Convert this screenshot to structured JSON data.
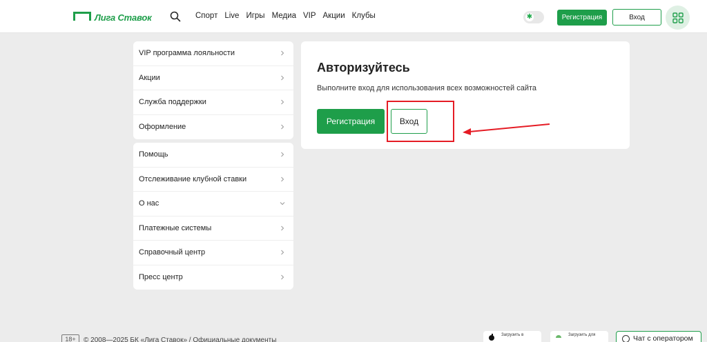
{
  "header": {
    "logo_text": "Лига Ставок",
    "nav": [
      "Спорт",
      "Live",
      "Игры",
      "Медиа",
      "VIP",
      "Акции",
      "Клубы"
    ],
    "register_label": "Регистрация",
    "login_label": "Вход",
    "toggle_glyph": "✱"
  },
  "sidebar": {
    "group1": [
      {
        "label": "VIP программа лояльности",
        "icon": "chevron-right-icon"
      },
      {
        "label": "Акции",
        "icon": "chevron-right-icon"
      },
      {
        "label": "Служба поддержки",
        "icon": "chevron-right-icon"
      },
      {
        "label": "Оформление",
        "icon": "chevron-right-icon"
      }
    ],
    "group2": [
      {
        "label": "Помощь",
        "icon": "chevron-right-icon"
      },
      {
        "label": "Отслеживание клубной ставки",
        "icon": "chevron-right-icon"
      },
      {
        "label": "О нас",
        "icon": "chevron-down-icon"
      },
      {
        "label": "Платежные системы",
        "icon": "chevron-right-icon"
      },
      {
        "label": "Справочный центр",
        "icon": "chevron-right-icon"
      },
      {
        "label": "Пресс центр",
        "icon": "chevron-right-icon"
      }
    ]
  },
  "auth": {
    "title": "Авторизуйтесь",
    "description": "Выполните вход для использования всех возможностей сайта",
    "register_label": "Регистрация",
    "login_label": "Вход"
  },
  "footer": {
    "age_badge": "18+",
    "copyright": "© 2008—2025 БК «Лига Ставок» / Официальные документы",
    "app_store_label": "Загрузить в",
    "google_play_label": "Загрузить для",
    "chat_label": "Чат с оператором"
  },
  "colors": {
    "brand_green": "#1e9e4a",
    "annotation_red": "#e51b24"
  }
}
